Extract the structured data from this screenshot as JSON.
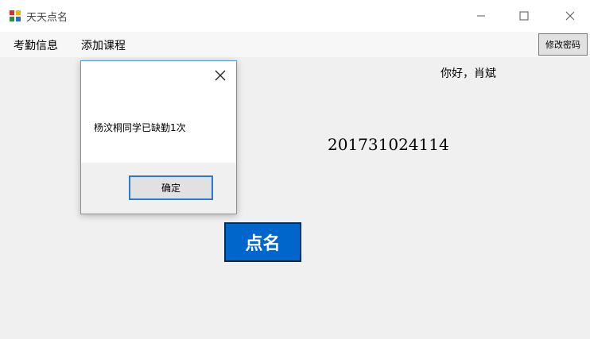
{
  "window": {
    "title": "天天点名"
  },
  "menu": {
    "items": [
      "考勤信息",
      "添加课程"
    ]
  },
  "header": {
    "change_password_label": "修改密码",
    "greeting": "你好，肖斌"
  },
  "main": {
    "student_id": "201731024114",
    "rollcall_label": "点名"
  },
  "dialog": {
    "message": "杨汶桐同学已缺勤1次",
    "ok_label": "确定"
  },
  "icons": {
    "app": "app-icon",
    "minimize": "minimize-icon",
    "maximize": "maximize-icon",
    "close": "close-icon",
    "dialog_close": "close-icon"
  },
  "colors": {
    "accent": "#0066cc",
    "dialog_border": "#5a9bd8",
    "ok_border": "#2b79d1"
  }
}
